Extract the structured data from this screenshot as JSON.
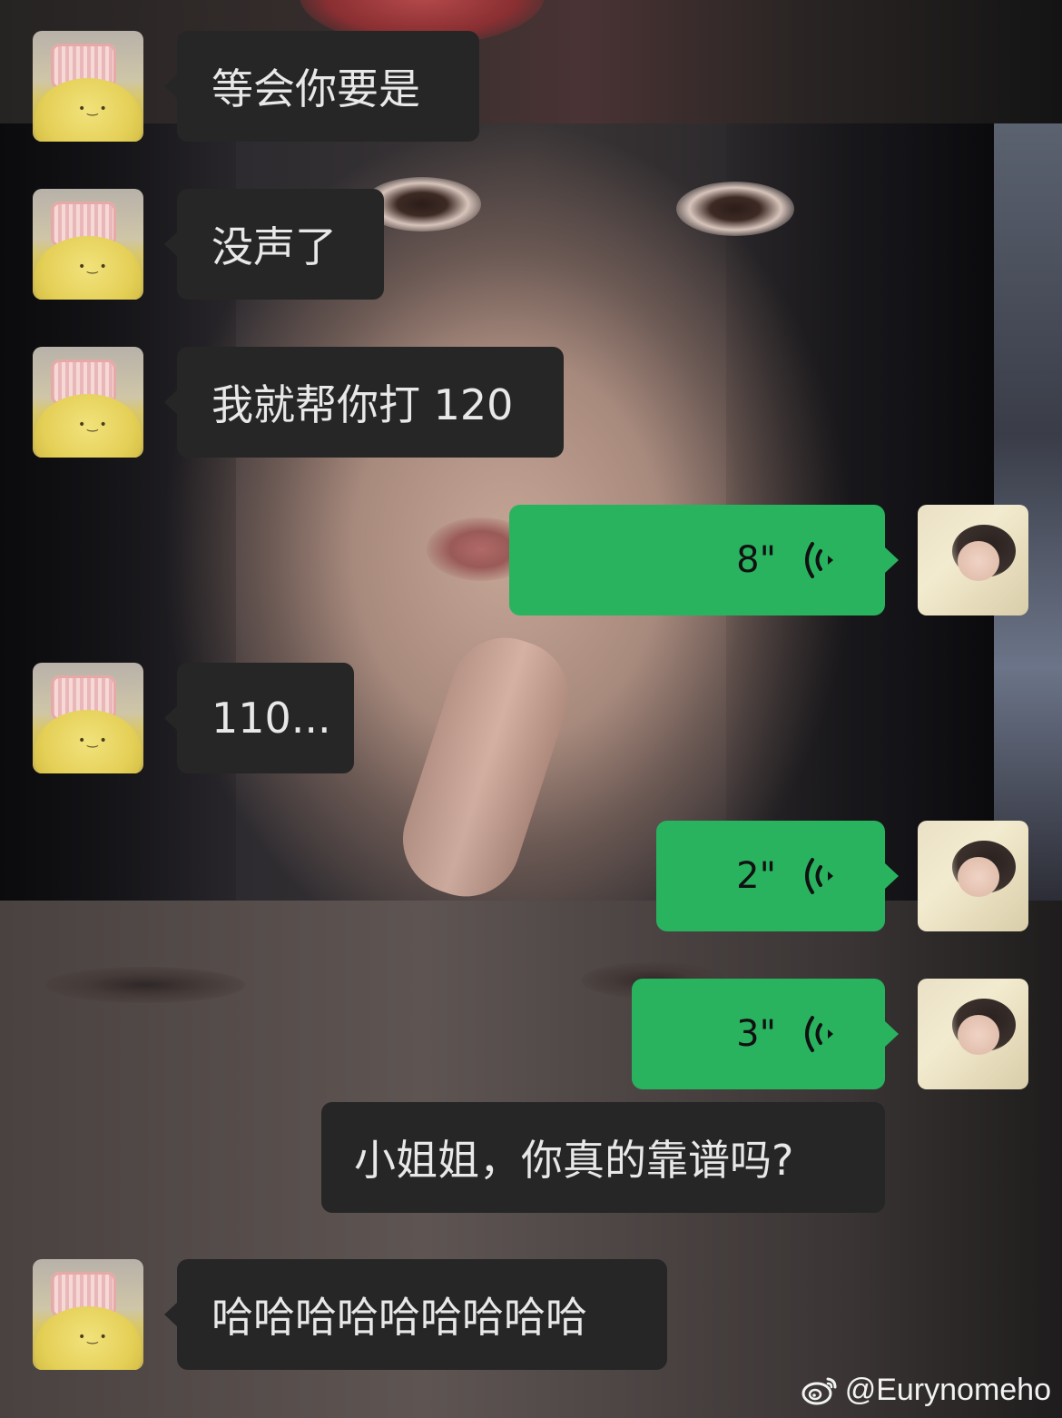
{
  "messages": [
    {
      "sender": "other",
      "type": "text",
      "text": "等会你要是"
    },
    {
      "sender": "other",
      "type": "text",
      "text": "没声了"
    },
    {
      "sender": "other",
      "type": "text",
      "text": "我就帮你打 120"
    },
    {
      "sender": "self",
      "type": "voice",
      "duration": "8\""
    },
    {
      "sender": "other",
      "type": "text",
      "text": "110..."
    },
    {
      "sender": "self",
      "type": "voice",
      "duration": "2\""
    },
    {
      "sender": "self",
      "type": "voice",
      "duration": "3\""
    },
    {
      "sender": "self",
      "type": "text",
      "text": "小姐姐，你真的靠谱吗?"
    },
    {
      "sender": "other",
      "type": "text",
      "text": "哈哈哈哈哈哈哈哈哈"
    }
  ],
  "watermark": {
    "text": "@Eurynomeho",
    "icon": "weibo-icon"
  },
  "colors": {
    "bubble_dark": "#262626",
    "bubble_green": "#29b35f",
    "text_light": "#e8e8e8"
  }
}
